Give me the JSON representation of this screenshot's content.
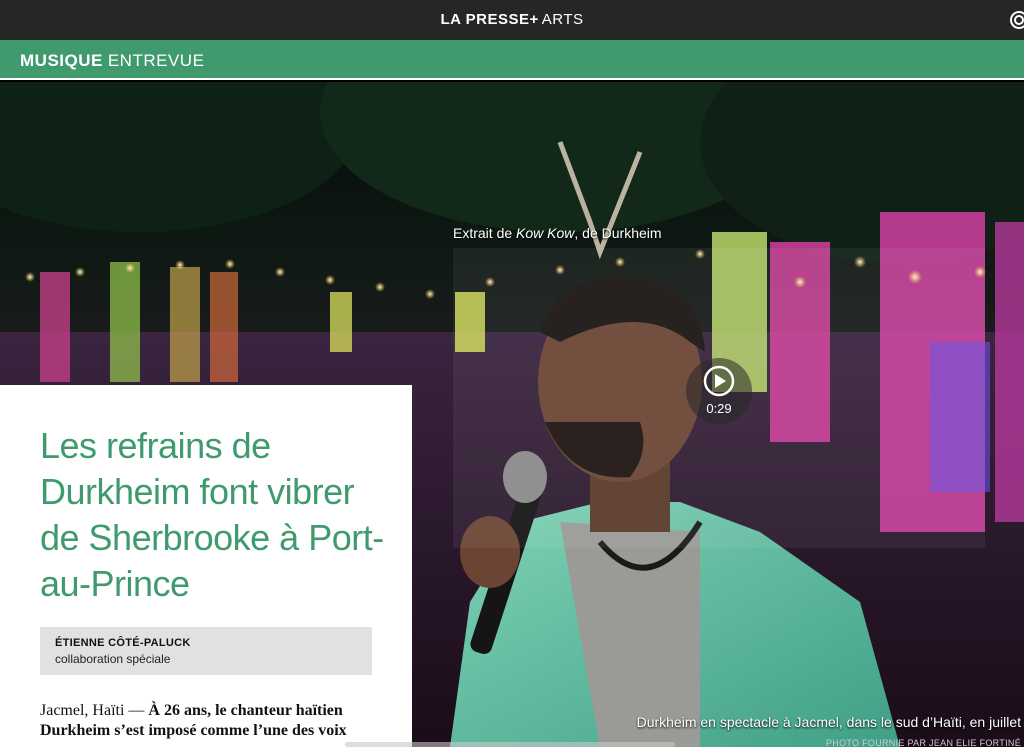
{
  "topbar": {
    "brand_name": "LA PRESSE+",
    "section": "ARTS",
    "share_icon": "share-icon"
  },
  "section_bar": {
    "category": "MUSIQUE",
    "type": "ENTREVUE"
  },
  "video": {
    "caption_prefix": "Extrait de ",
    "caption_title": "Kow Kow",
    "caption_suffix": ", de Durkheim",
    "duration": "0:29",
    "play_icon": "play-icon"
  },
  "photo": {
    "caption": "Durkheim en spectacle à Jacmel, dans le sud d’Haïti, en juillet",
    "credit": "PHOTO FOURNIE PAR JEAN ELIE FORTINÉ"
  },
  "article": {
    "headline": "Les refrains de Durkheim font vibrer de Sherbrooke à Port-au-Prince",
    "author": "ÉTIENNE CÔTÉ-PALUCK",
    "author_role": "collaboration spéciale",
    "dateline": "Jacmel, Haïti —",
    "lede_bold": "À 26 ans, le chanteur haïtien Durkheim s’est imposé comme l’une des voix"
  },
  "colors": {
    "accent": "#3f9a6e",
    "topbar": "#262626",
    "byline_bg": "#e1e1e1"
  }
}
